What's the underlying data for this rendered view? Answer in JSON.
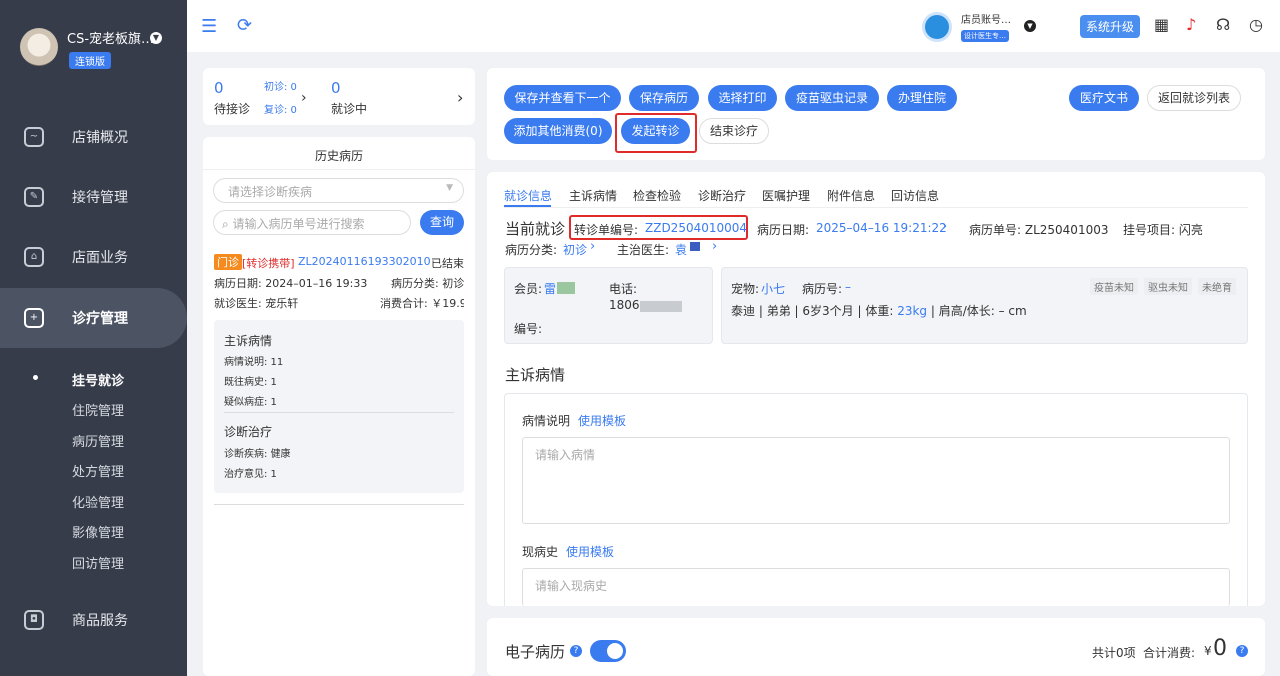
{
  "sidebar": {
    "store_name": "CS-宠老板旗…",
    "chain_badge": "连锁版",
    "nav": [
      {
        "label": "店铺概况"
      },
      {
        "label": "接待管理"
      },
      {
        "label": "店面业务"
      },
      {
        "label": "诊疗管理"
      },
      {
        "label": "商品服务"
      }
    ],
    "sub": [
      {
        "label": "挂号就诊"
      },
      {
        "label": "住院管理"
      },
      {
        "label": "病历管理"
      },
      {
        "label": "处方管理"
      },
      {
        "label": "化验管理"
      },
      {
        "label": "影像管理"
      },
      {
        "label": "回访管理"
      }
    ]
  },
  "topbar": {
    "account_name": "店员账号…",
    "account_tag": "设计医生专…",
    "upgrade": "系统升级"
  },
  "queue": {
    "waiting_count": "0",
    "waiting_label": "待接诊",
    "first_visit": "初诊: 0",
    "return_visit": "复诊: 0",
    "in_progress_count": "0",
    "in_progress_label": "就诊中"
  },
  "history": {
    "title": "历史病历",
    "diagnosis_placeholder": "请选择诊断疾病",
    "search_placeholder": "请输入病历单号进行搜索",
    "search_btn": "查询",
    "record": {
      "visit_type": "门诊",
      "tag": "[转诊携带]",
      "record_no": "ZL20240116193302010",
      "status": "已结束",
      "date": "病历日期: 2024–01–16 19:33",
      "category": "病历分类: 初诊",
      "doctor": "就诊医生: 宠乐轩",
      "total": "消费合计: ￥19.9",
      "complaint_title": "主诉病情",
      "desc": "病情说明:  11",
      "past": "既往病史:  1",
      "suspect": "疑似病症:  1",
      "diag_title": "诊断治疗",
      "disease": "诊断疾病: 健康",
      "advice": "治疗意见:  1"
    }
  },
  "actions": {
    "save_next": "保存并查看下一个",
    "save": "保存病历",
    "print": "选择打印",
    "vaccine": "疫苗驱虫记录",
    "hospital": "办理住院",
    "doc": "医疗文书",
    "back": "返回就诊列表",
    "add_other": "添加其他消费(0)",
    "referral": "发起转诊",
    "end": "结束诊疗"
  },
  "tabs": [
    "就诊信息",
    "主诉病情",
    "检查检验",
    "诊断治疗",
    "医嘱护理",
    "附件信息",
    "回访信息"
  ],
  "visit": {
    "title": "当前就诊",
    "referral_label": "转诊单编号: ",
    "referral_no": "ZZD2504010004",
    "date_label": "病历日期: ",
    "date": "2025–04–16 19:21:22",
    "record_label": "病历单号: ZL250401003",
    "project": "挂号项目: 闪亮",
    "cat_label": "病历分类: ",
    "cat": "初诊",
    "doctor_label": "主治医生: ",
    "doctor": "袁"
  },
  "member": {
    "label": "会员: ",
    "name": "雷",
    "phone_label": "电话:",
    "phone": "1806",
    "no_label": "编号:"
  },
  "pet": {
    "label": "宠物: ",
    "name": "小七",
    "record_label": "病历号: ",
    "record": "–",
    "breed": "泰迪",
    "gender": "弟弟",
    "age": "6岁3个月",
    "weight_label": "体重: ",
    "weight": "23kg",
    "shoulder": "肩高/体长: – cm",
    "tags": [
      "疫苗未知",
      "驱虫未知",
      "未绝育"
    ]
  },
  "complaint": {
    "title": "主诉病情",
    "desc_label": "病情说明",
    "template": "使用模板",
    "desc_placeholder": "请输入病情",
    "hist_label": "现病史",
    "hist_placeholder": "请输入现病史"
  },
  "emr": {
    "title": "电子病历",
    "count": "共计0项",
    "total_label": "合计消费: ",
    "currency": "¥",
    "total": "0"
  }
}
